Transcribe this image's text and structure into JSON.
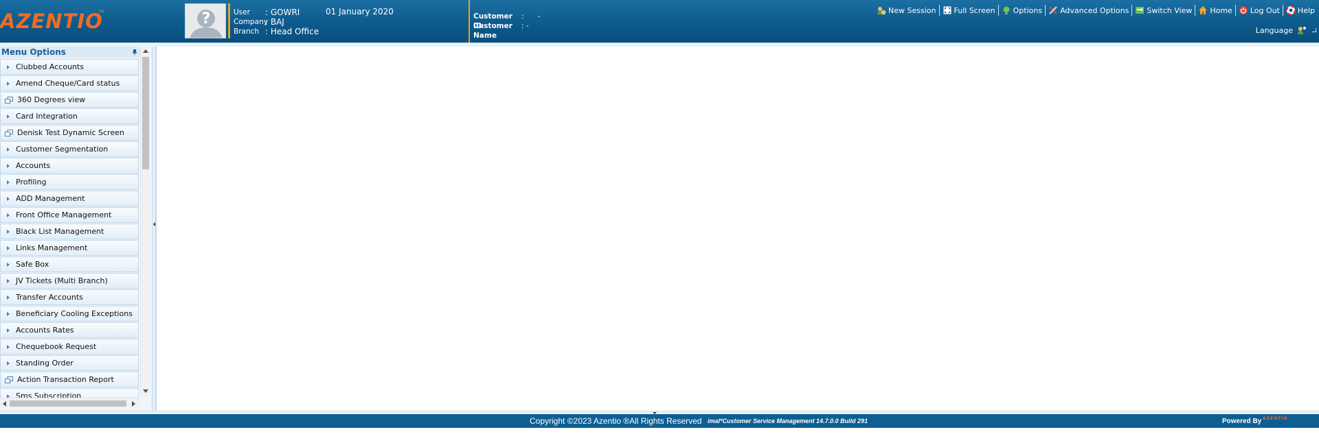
{
  "app": {
    "logo_text": "AZENTIO",
    "logo_tm": "TM"
  },
  "user_info": {
    "user_label": "User",
    "user_value": ": GOWRI",
    "company_label": "Company",
    "company_value": ": BAJ",
    "branch_label": "Branch",
    "branch_value": ": Head Office",
    "date": "01 January 2020"
  },
  "customer": {
    "id_label": "Customer ID",
    "id_value": ":      -",
    "name_label": "Customer Name",
    "name_value": ": -"
  },
  "toolbar": {
    "items": [
      {
        "label": "New Session",
        "icon": "new-session-icon"
      },
      {
        "label": "Full Screen",
        "icon": "full-screen-icon"
      },
      {
        "label": "Options",
        "icon": "options-icon"
      },
      {
        "label": "Advanced Options",
        "icon": "advanced-options-icon"
      },
      {
        "label": "Switch View",
        "icon": "switch-view-icon"
      },
      {
        "label": "Home",
        "icon": "home-icon"
      },
      {
        "label": "Log Out",
        "icon": "log-out-icon"
      },
      {
        "label": "Help",
        "icon": "help-icon"
      }
    ],
    "language_label": "Language"
  },
  "sidebar": {
    "title": "Menu Options",
    "items": [
      {
        "label": "Clubbed Accounts",
        "type": "folder"
      },
      {
        "label": "Amend Cheque/Card status",
        "type": "folder"
      },
      {
        "label": "360 Degrees view",
        "type": "screen"
      },
      {
        "label": "Card Integration",
        "type": "folder"
      },
      {
        "label": "Denisk Test Dynamic Screen",
        "type": "screen"
      },
      {
        "label": "Customer Segmentation",
        "type": "folder"
      },
      {
        "label": "Accounts",
        "type": "folder"
      },
      {
        "label": "Profiling",
        "type": "folder"
      },
      {
        "label": "ADD Management",
        "type": "folder"
      },
      {
        "label": "Front Office Management",
        "type": "folder"
      },
      {
        "label": "Black List Management",
        "type": "folder"
      },
      {
        "label": "Links Management",
        "type": "folder"
      },
      {
        "label": "Safe Box",
        "type": "folder"
      },
      {
        "label": "JV Tickets (Multi Branch)",
        "type": "folder"
      },
      {
        "label": "Transfer Accounts",
        "type": "folder"
      },
      {
        "label": "Beneficiary Cooling Exceptions",
        "type": "folder"
      },
      {
        "label": "Accounts Rates",
        "type": "folder"
      },
      {
        "label": "Chequebook Request",
        "type": "folder"
      },
      {
        "label": "Standing Order",
        "type": "folder"
      },
      {
        "label": "Action Transaction Report",
        "type": "screen"
      },
      {
        "label": "Sms Subscription",
        "type": "folder"
      }
    ]
  },
  "footer": {
    "copyright": "Copyright ©2023 Azentio ®All Rights Reserved",
    "product": "imal*Customer Service Management 14.7.0.0 Build 291",
    "powered_by": "Powered By",
    "powered_logo": "AZENTIO"
  },
  "colors": {
    "header": "#0d5a8c",
    "accent": "#f26b21",
    "separator": "#e2a52b",
    "sidebar_bg": "#eef5fb",
    "footer": "#0d5f93"
  }
}
